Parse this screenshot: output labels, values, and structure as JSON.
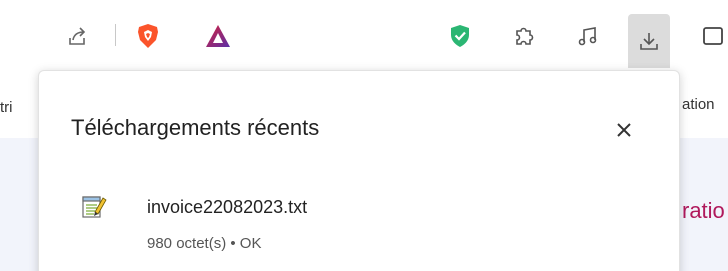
{
  "toolbar": {
    "icons": [
      "share-icon",
      "brave-shields-icon",
      "brave-rewards-icon",
      "vpn-shield-icon",
      "extensions-icon",
      "media-icon",
      "downloads-icon",
      "sidebar-icon"
    ]
  },
  "background": {
    "left_text": "tri",
    "right_text": "ation",
    "content_text": "ratio"
  },
  "downloads_popup": {
    "title": "Téléchargements récents",
    "items": [
      {
        "filename": "invoice22082023.txt",
        "status": "980 octet(s) • OK"
      }
    ]
  },
  "colors": {
    "brave_orange": "#fb542b",
    "rewards_red": "#d4203b",
    "rewards_purple": "#5b2fa8",
    "shield_green": "#2bb673",
    "accent_pink": "#b0195c"
  }
}
